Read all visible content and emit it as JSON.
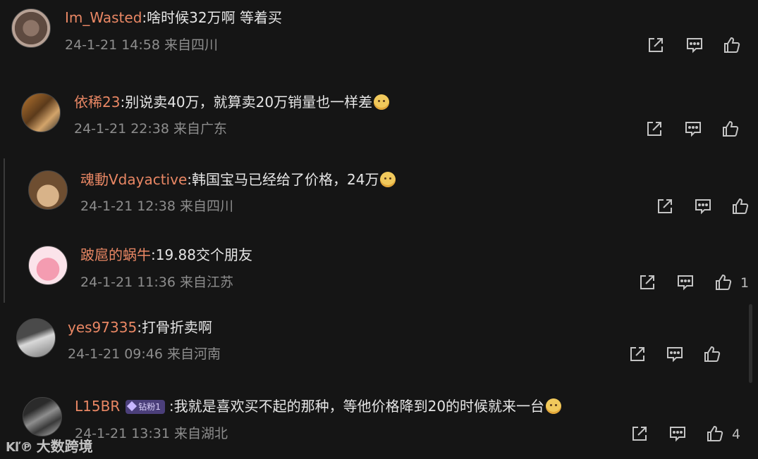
{
  "colors": {
    "username": "#e98764",
    "text": "#e6e6e6",
    "meta": "#8d8d8d",
    "background": "#151515"
  },
  "comments": [
    {
      "username": "Im_Wasted",
      "text": "啥时候32万啊 等着买",
      "emoji": false,
      "badge": "",
      "time": "24-1-21 14:58",
      "location": "来自四川",
      "likes": ""
    },
    {
      "username": "依稀23",
      "text": "别说卖40万，就算卖20万销量也一样差",
      "emoji": true,
      "badge": "",
      "time": "24-1-21 22:38",
      "location": "来自广东",
      "likes": ""
    },
    {
      "username": "魂動Vdayactive",
      "text": "韩国宝马已经给了价格，24万",
      "emoji": true,
      "badge": "",
      "time": "24-1-21 12:38",
      "location": "来自四川",
      "likes": ""
    },
    {
      "username": "跛扈的蜗牛",
      "text": "19.88交个朋友",
      "emoji": false,
      "badge": "",
      "time": "24-1-21 11:36",
      "location": "来自江苏",
      "likes": "1"
    },
    {
      "username": "yes97335",
      "text": "打骨折卖啊",
      "emoji": false,
      "badge": "",
      "time": "24-1-21 09:46",
      "location": "来自河南",
      "likes": ""
    },
    {
      "username": "L15BR",
      "text": "我就是喜欢买不起的那种，等他价格降到20的时候就来一台",
      "emoji": true,
      "badge": "钻粉1",
      "time": "24-1-21 13:31",
      "location": "来自湖北",
      "likes": "4"
    }
  ],
  "icons": {
    "share": "share-icon",
    "comment": "comment-icon",
    "like": "thumbs-up-icon"
  },
  "watermark": {
    "logo": "Kľ℗",
    "text": "大数跨境"
  }
}
